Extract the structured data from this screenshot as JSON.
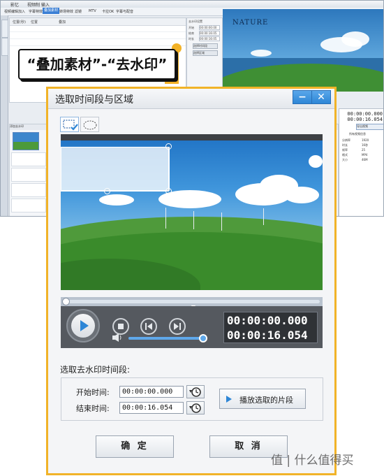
{
  "background_app": {
    "title": "影忆",
    "title_tabs": [
      "视频制",
      "输入"
    ],
    "menu": [
      "视频",
      "编辑",
      "加入",
      "字幕特效",
      "叠加素材",
      "转场特效",
      "滤镜",
      "MTV",
      "卡拉OK",
      "字幕与配音"
    ],
    "active_menu_index": 4,
    "left_tabs": [
      "叠加素材",
      "加贴图"
    ],
    "list_headers": [
      "位置(秒)",
      "位置",
      "叠加"
    ],
    "props": {
      "header": "去水印设置",
      "fields": [
        "开始",
        "结束",
        "时长"
      ],
      "values": [
        "00:00:00:00",
        "00:00:16:05",
        "00:00:16:05"
      ],
      "buttons": [
        "选择时间段",
        "选择区域"
      ]
    },
    "preview_text": "NATURE",
    "right_panel": {
      "time_current": "00:00:00.000",
      "time_total": "00:00:16.054",
      "button": "导出视频",
      "header": "所有视频信息",
      "rows": [
        {
          "label": "分辨率",
          "value": "1920"
        },
        {
          "label": "时长",
          "value": "16秒"
        },
        {
          "label": "帧率",
          "value": "25"
        },
        {
          "label": "格式",
          "value": "MP4"
        },
        {
          "label": "大小",
          "value": "46M"
        }
      ]
    },
    "lower_header": "添加去水印",
    "thumb_label": "视频"
  },
  "callout": {
    "text": "“叠加素材”-“去水印”"
  },
  "dialog": {
    "title": "选取时间段与区域",
    "minimize_glyph": "−",
    "close_glyph": "✕",
    "tools": {
      "rect_icon": "rect-select-icon",
      "ellipse_icon": "ellipse-select-icon"
    },
    "player": {
      "current_time": "00:00:00.000",
      "total_time": "00:00:16.054",
      "seek_fraction": 0,
      "volume_fraction": 1.0
    },
    "section_title": "选取去水印时间段:",
    "start_label": "开始时间:",
    "start_value": "00:00:00.000",
    "end_label": "结束时间:",
    "end_value": "00:00:16.054",
    "play_selection_label": "播放选取的片段",
    "ok_label": "确 定",
    "cancel_label": "取 消"
  },
  "watermark": "值 | 什么值得买",
  "colors": {
    "highlight": "#f1b328",
    "accent_blue": "#2d86d6",
    "titlebar_btn": "#3a8ee0",
    "player_bg": "#55595f"
  }
}
